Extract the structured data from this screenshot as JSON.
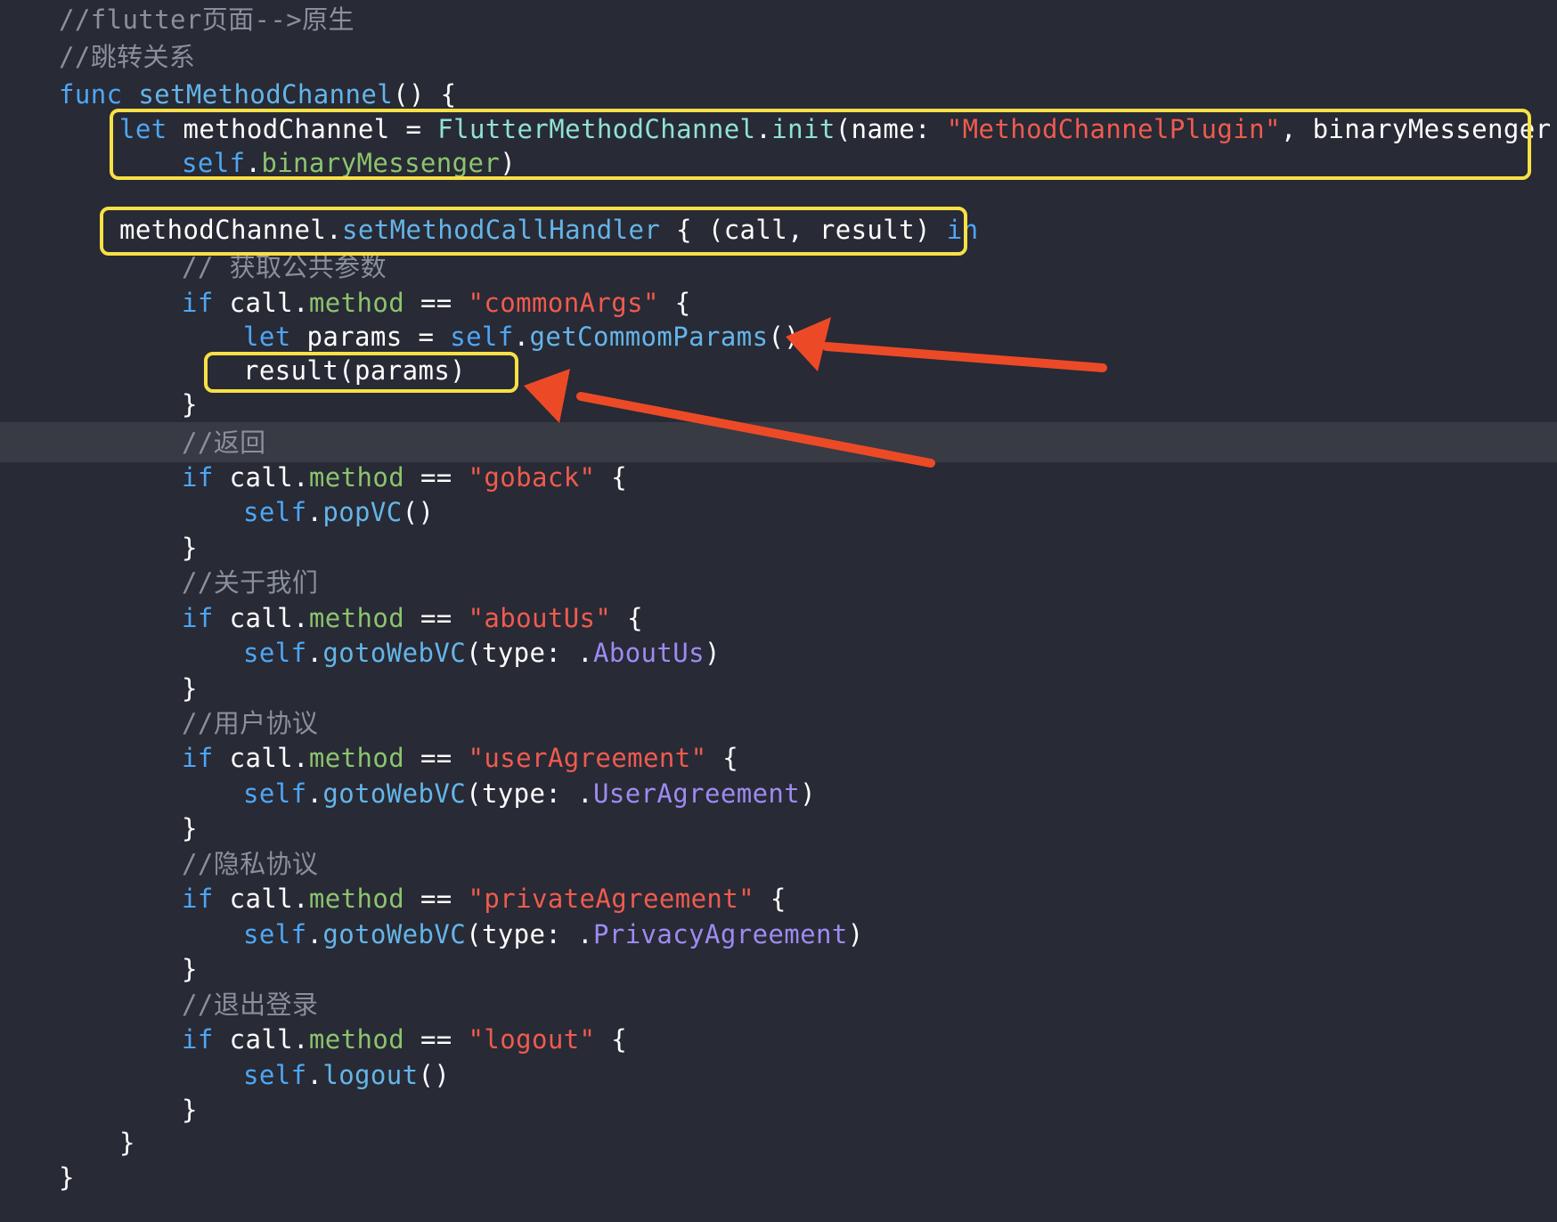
{
  "lines": [
    {
      "indent": 0,
      "tokens": [
        {
          "t": "comment",
          "v": "//flutter页面-->原生"
        }
      ]
    },
    {
      "indent": 0,
      "tokens": [
        {
          "t": "comment",
          "v": "//跳转关系"
        }
      ]
    },
    {
      "indent": 0,
      "tokens": [
        {
          "t": "kw",
          "v": "func "
        },
        {
          "t": "fn",
          "v": "setMethodChannel"
        },
        {
          "t": "plain",
          "v": "() {"
        }
      ]
    },
    {
      "indent": 1,
      "tokens": [
        {
          "t": "kw",
          "v": "let "
        },
        {
          "t": "plain",
          "v": "methodChannel = "
        },
        {
          "t": "type",
          "v": "FlutterMethodChannel"
        },
        {
          "t": "plain",
          "v": "."
        },
        {
          "t": "type",
          "v": "init"
        },
        {
          "t": "plain",
          "v": "(name: "
        },
        {
          "t": "str",
          "v": "\"MethodChannelPlugin\""
        },
        {
          "t": "plain",
          "v": ", binaryMessenger:"
        }
      ]
    },
    {
      "indent": 2,
      "tokens": [
        {
          "t": "kw",
          "v": "self"
        },
        {
          "t": "plain",
          "v": "."
        },
        {
          "t": "prop",
          "v": "binaryMessenger"
        },
        {
          "t": "plain",
          "v": ")"
        }
      ]
    },
    {
      "indent": 0,
      "tokens": []
    },
    {
      "indent": 1,
      "tokens": [
        {
          "t": "plain",
          "v": "methodChannel."
        },
        {
          "t": "fn",
          "v": "setMethodCallHandler"
        },
        {
          "t": "plain",
          "v": " { (call, result) "
        },
        {
          "t": "kw",
          "v": "in"
        }
      ]
    },
    {
      "indent": 2,
      "tokens": [
        {
          "t": "comment",
          "v": "// 获取公共参数"
        }
      ]
    },
    {
      "indent": 2,
      "tokens": [
        {
          "t": "kw",
          "v": "if "
        },
        {
          "t": "plain",
          "v": "call."
        },
        {
          "t": "prop",
          "v": "method"
        },
        {
          "t": "plain",
          "v": " == "
        },
        {
          "t": "str",
          "v": "\"commonArgs\""
        },
        {
          "t": "plain",
          "v": " {"
        }
      ]
    },
    {
      "indent": 3,
      "tokens": [
        {
          "t": "kw",
          "v": "let "
        },
        {
          "t": "plain",
          "v": "params = "
        },
        {
          "t": "kw",
          "v": "self"
        },
        {
          "t": "plain",
          "v": "."
        },
        {
          "t": "fn",
          "v": "getCommomParams"
        },
        {
          "t": "plain",
          "v": "()"
        }
      ]
    },
    {
      "indent": 3,
      "tokens": [
        {
          "t": "plain",
          "v": "result(params)"
        }
      ]
    },
    {
      "indent": 2,
      "tokens": [
        {
          "t": "plain",
          "v": "}"
        }
      ]
    },
    {
      "indent": 2,
      "tokens": [
        {
          "t": "comment",
          "v": "//返回"
        }
      ]
    },
    {
      "indent": 2,
      "tokens": [
        {
          "t": "kw",
          "v": "if "
        },
        {
          "t": "plain",
          "v": "call."
        },
        {
          "t": "prop",
          "v": "method"
        },
        {
          "t": "plain",
          "v": " == "
        },
        {
          "t": "str",
          "v": "\"goback\""
        },
        {
          "t": "plain",
          "v": " {"
        }
      ]
    },
    {
      "indent": 3,
      "tokens": [
        {
          "t": "kw",
          "v": "self"
        },
        {
          "t": "plain",
          "v": "."
        },
        {
          "t": "fn",
          "v": "popVC"
        },
        {
          "t": "plain",
          "v": "()"
        }
      ]
    },
    {
      "indent": 2,
      "tokens": [
        {
          "t": "plain",
          "v": "}"
        }
      ]
    },
    {
      "indent": 2,
      "tokens": [
        {
          "t": "comment",
          "v": "//关于我们"
        }
      ]
    },
    {
      "indent": 2,
      "tokens": [
        {
          "t": "kw",
          "v": "if "
        },
        {
          "t": "plain",
          "v": "call."
        },
        {
          "t": "prop",
          "v": "method"
        },
        {
          "t": "plain",
          "v": " == "
        },
        {
          "t": "str",
          "v": "\"aboutUs\""
        },
        {
          "t": "plain",
          "v": " {"
        }
      ]
    },
    {
      "indent": 3,
      "tokens": [
        {
          "t": "kw",
          "v": "self"
        },
        {
          "t": "plain",
          "v": "."
        },
        {
          "t": "fn",
          "v": "gotoWebVC"
        },
        {
          "t": "plain",
          "v": "(type: ."
        },
        {
          "t": "enum",
          "v": "AboutUs"
        },
        {
          "t": "plain",
          "v": ")"
        }
      ]
    },
    {
      "indent": 2,
      "tokens": [
        {
          "t": "plain",
          "v": "}"
        }
      ]
    },
    {
      "indent": 2,
      "tokens": [
        {
          "t": "comment",
          "v": "//用户协议"
        }
      ]
    },
    {
      "indent": 2,
      "tokens": [
        {
          "t": "kw",
          "v": "if "
        },
        {
          "t": "plain",
          "v": "call."
        },
        {
          "t": "prop",
          "v": "method"
        },
        {
          "t": "plain",
          "v": " == "
        },
        {
          "t": "str",
          "v": "\"userAgreement\""
        },
        {
          "t": "plain",
          "v": " {"
        }
      ]
    },
    {
      "indent": 3,
      "tokens": [
        {
          "t": "kw",
          "v": "self"
        },
        {
          "t": "plain",
          "v": "."
        },
        {
          "t": "fn",
          "v": "gotoWebVC"
        },
        {
          "t": "plain",
          "v": "(type: ."
        },
        {
          "t": "enum",
          "v": "UserAgreement"
        },
        {
          "t": "plain",
          "v": ")"
        }
      ]
    },
    {
      "indent": 2,
      "tokens": [
        {
          "t": "plain",
          "v": "}"
        }
      ]
    },
    {
      "indent": 2,
      "tokens": [
        {
          "t": "comment",
          "v": "//隐私协议"
        }
      ]
    },
    {
      "indent": 2,
      "tokens": [
        {
          "t": "kw",
          "v": "if "
        },
        {
          "t": "plain",
          "v": "call."
        },
        {
          "t": "prop",
          "v": "method"
        },
        {
          "t": "plain",
          "v": " == "
        },
        {
          "t": "str",
          "v": "\"privateAgreement\""
        },
        {
          "t": "plain",
          "v": " {"
        }
      ]
    },
    {
      "indent": 3,
      "tokens": [
        {
          "t": "kw",
          "v": "self"
        },
        {
          "t": "plain",
          "v": "."
        },
        {
          "t": "fn",
          "v": "gotoWebVC"
        },
        {
          "t": "plain",
          "v": "(type: ."
        },
        {
          "t": "enum",
          "v": "PrivacyAgreement"
        },
        {
          "t": "plain",
          "v": ")"
        }
      ]
    },
    {
      "indent": 2,
      "tokens": [
        {
          "t": "plain",
          "v": "}"
        }
      ]
    },
    {
      "indent": 2,
      "tokens": [
        {
          "t": "comment",
          "v": "//退出登录"
        }
      ]
    },
    {
      "indent": 2,
      "tokens": [
        {
          "t": "kw",
          "v": "if "
        },
        {
          "t": "plain",
          "v": "call."
        },
        {
          "t": "prop",
          "v": "method"
        },
        {
          "t": "plain",
          "v": " == "
        },
        {
          "t": "str",
          "v": "\"logout\""
        },
        {
          "t": "plain",
          "v": " {"
        }
      ]
    },
    {
      "indent": 3,
      "tokens": [
        {
          "t": "kw",
          "v": "self"
        },
        {
          "t": "plain",
          "v": "."
        },
        {
          "t": "fn",
          "v": "logout"
        },
        {
          "t": "plain",
          "v": "()"
        }
      ]
    },
    {
      "indent": 2,
      "tokens": [
        {
          "t": "plain",
          "v": "}"
        }
      ]
    },
    {
      "indent": 1,
      "tokens": [
        {
          "t": "plain",
          "v": "}"
        }
      ]
    },
    {
      "indent": 0,
      "tokens": [
        {
          "t": "plain",
          "v": "}"
        }
      ]
    }
  ],
  "colors": {
    "background": "#282a35",
    "current_line": "#383a44",
    "annotation_box": "#f8e046",
    "annotation_arrow": "#ec4a26"
  }
}
